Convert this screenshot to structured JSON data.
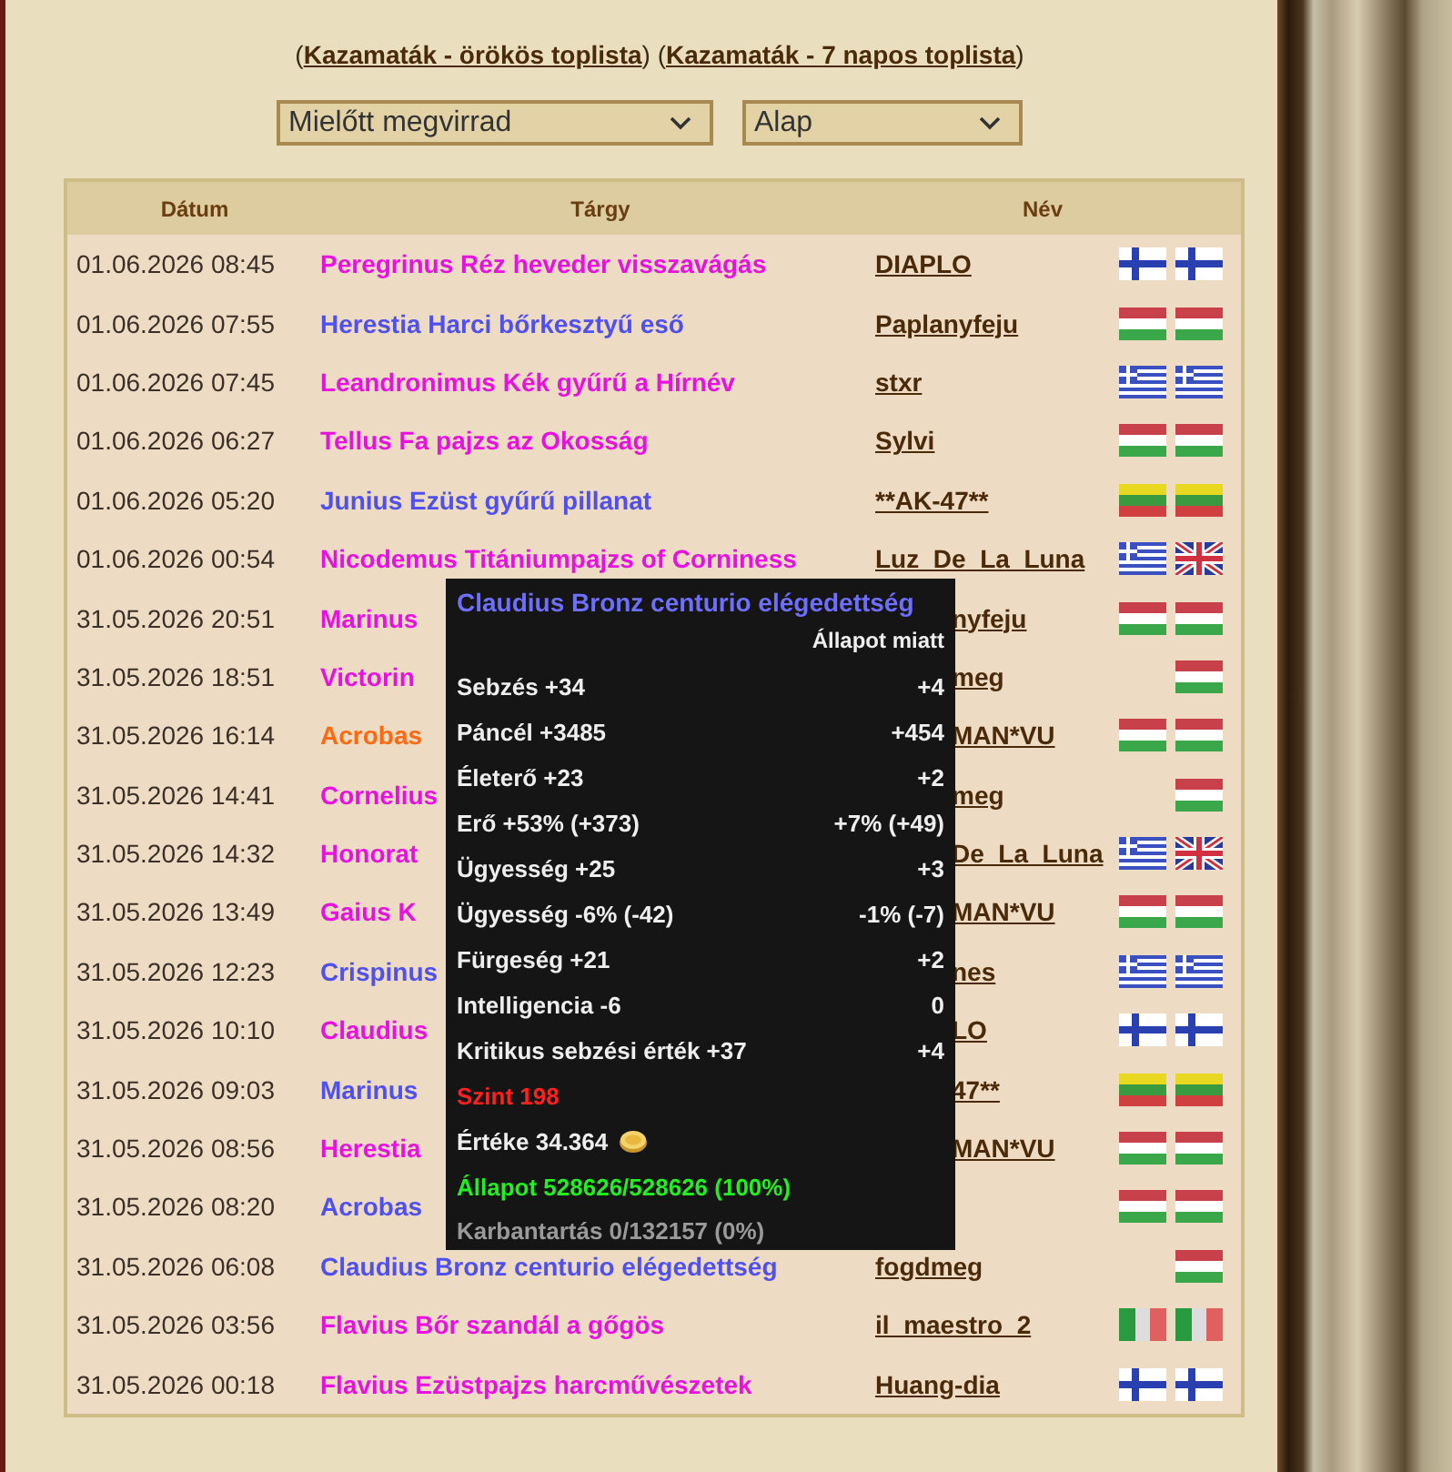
{
  "links": [
    {
      "kind": "text",
      "text": "("
    },
    {
      "kind": "link",
      "text": "Kazamaták - örökös toplista"
    },
    {
      "kind": "text",
      "text": ") ("
    },
    {
      "kind": "link",
      "text": "Kazamaták - 7 napos toplista"
    },
    {
      "kind": "text",
      "text": ")"
    }
  ],
  "selects": [
    {
      "value": "Mielőtt megvirrad"
    },
    {
      "value": "Alap"
    }
  ],
  "table": {
    "columns": [
      "Dátum",
      "Tárgy",
      "Név"
    ],
    "rows": [
      {
        "date": "01.06.2026 08:45",
        "item": "Peregrinus Réz heveder visszavágás",
        "color": "#e812e0",
        "name": "DIAPLO",
        "flags": [
          {
            "kind": "fi"
          },
          {
            "kind": "fi"
          }
        ]
      },
      {
        "date": "01.06.2026 07:55",
        "item": "Herestia Harci bőrkesztyű eső",
        "color": "#5050f0",
        "name": "Paplanyfeju",
        "flags": [
          {
            "kind": "hu"
          },
          {
            "kind": "hu"
          }
        ]
      },
      {
        "date": "01.06.2026 07:45",
        "item": "Leandronimus Kék gyűrű a Hírnév",
        "color": "#e812e0",
        "name": "stxr",
        "flags": [
          {
            "kind": "gr"
          },
          {
            "kind": "gr"
          }
        ]
      },
      {
        "date": "01.06.2026 06:27",
        "item": "Tellus Fa pajzs az Okosság",
        "color": "#e812e0",
        "name": "Sylvi",
        "flags": [
          {
            "kind": "hu"
          },
          {
            "kind": "hu"
          }
        ]
      },
      {
        "date": "01.06.2026 05:20",
        "item": "Junius Ezüst gyűrű pillanat",
        "color": "#5050f0",
        "name": "**AK-47**",
        "flags": [
          {
            "kind": "lt"
          },
          {
            "kind": "lt"
          }
        ]
      },
      {
        "date": "01.06.2026 00:54",
        "item": "Nicodemus Titániumpajzs of Corniness",
        "color": "#e812e0",
        "name": "Luz_De_La_Luna",
        "flags": [
          {
            "kind": "gr"
          },
          {
            "kind": "gb"
          }
        ]
      },
      {
        "date": "31.05.2026 20:51",
        "item": "Marinus",
        "color": "#e812e0",
        "name": "nyfeju",
        "name_hidden_start": true,
        "flags": [
          {
            "kind": "hu"
          },
          {
            "kind": "hu"
          }
        ]
      },
      {
        "date": "31.05.2026 18:51",
        "item": "Victorin",
        "color": "#e812e0",
        "name": "meg",
        "name_hidden_start": true,
        "flags": [
          {
            "kind": "hu"
          }
        ]
      },
      {
        "date": "31.05.2026 16:14",
        "item": "Acrobas",
        "color": "#ff6a10",
        "name": "MAN*VU",
        "name_hidden_start": true,
        "flags": [
          {
            "kind": "hu"
          },
          {
            "kind": "hu"
          }
        ]
      },
      {
        "date": "31.05.2026 14:41",
        "item": "Cornelius",
        "color": "#e812e0",
        "name": "meg",
        "name_hidden_start": true,
        "flags": [
          {
            "kind": "hu"
          }
        ]
      },
      {
        "date": "31.05.2026 14:32",
        "item": "Honorat",
        "color": "#e812e0",
        "name": "De_La_Luna",
        "name_hidden_start": true,
        "flags": [
          {
            "kind": "gr"
          },
          {
            "kind": "gb"
          }
        ]
      },
      {
        "date": "31.05.2026 13:49",
        "item": "Gaius K",
        "color": "#e812e0",
        "name": "MAN*VU",
        "name_hidden_start": true,
        "flags": [
          {
            "kind": "hu"
          },
          {
            "kind": "hu"
          }
        ]
      },
      {
        "date": "31.05.2026 12:23",
        "item": "Crispinus",
        "color": "#5050f0",
        "name": "nes",
        "name_hidden_start": true,
        "flags": [
          {
            "kind": "gr"
          },
          {
            "kind": "gr"
          }
        ]
      },
      {
        "date": "31.05.2026 10:10",
        "item": "Claudius",
        "color": "#e812e0",
        "name": "LO",
        "name_hidden_start": true,
        "flags": [
          {
            "kind": "fi"
          },
          {
            "kind": "fi"
          }
        ]
      },
      {
        "date": "31.05.2026 09:03",
        "item": "Marinus",
        "color": "#5050f0",
        "name": "47**",
        "name_hidden_start": true,
        "flags": [
          {
            "kind": "lt"
          },
          {
            "kind": "lt"
          }
        ]
      },
      {
        "date": "31.05.2026 08:56",
        "item": "Herestia",
        "color": "#e812e0",
        "name": "MAN*VU",
        "name_hidden_start": true,
        "flags": [
          {
            "kind": "hu"
          },
          {
            "kind": "hu"
          }
        ]
      },
      {
        "date": "31.05.2026 08:20",
        "item": "Acrobas",
        "color": "#5050f0",
        "flags": [
          {
            "kind": "hu"
          },
          {
            "kind": "hu"
          }
        ]
      },
      {
        "date": "31.05.2026 06:08",
        "item": "Claudius Bronz centurio elégedettség",
        "color": "#5050f0",
        "name": "fogdmeg",
        "flags": [
          {
            "kind": "hu"
          }
        ]
      },
      {
        "date": "31.05.2026 03:56",
        "item": "Flavius Bőr szandál a gőgös",
        "color": "#e812e0",
        "name": "il_maestro_2",
        "flags": [
          {
            "kind": "it"
          },
          {
            "kind": "it"
          }
        ]
      },
      {
        "date": "31.05.2026 00:18",
        "item": "Flavius Ezüstpajzs harcművészetek",
        "color": "#e812e0",
        "name": "Huang-dia",
        "flags": [
          {
            "kind": "fi"
          },
          {
            "kind": "fi"
          }
        ]
      }
    ]
  },
  "tooltip": {
    "title": "Claudius Bronz centurio elégedettség",
    "subheader": "Állapot miatt",
    "lines": [
      {
        "kind": "stat",
        "label": "Sebzés +34",
        "bonus": "+4"
      },
      {
        "kind": "stat",
        "label": "Páncél +3485",
        "bonus": "+454"
      },
      {
        "kind": "stat",
        "label": "Életerő +23",
        "bonus": "+2"
      },
      {
        "kind": "stat",
        "label": "Erő +53% (+373)",
        "bonus": "+7% (+49)"
      },
      {
        "kind": "stat",
        "label": "Ügyesség +25",
        "bonus": "+3"
      },
      {
        "kind": "stat",
        "label": "Ügyesség -6% (-42)",
        "bonus": "-1% (-7)"
      },
      {
        "kind": "stat",
        "label": "Fürgeség +21",
        "bonus": "+2"
      },
      {
        "kind": "stat",
        "label": "Intelligencia -6",
        "bonus": "0"
      },
      {
        "kind": "stat",
        "label": "Kritikus sebzési érték +37",
        "bonus": "+4"
      },
      {
        "kind": "level",
        "label": "Szint 198"
      },
      {
        "kind": "value",
        "label": "Értéke 34.364"
      },
      {
        "kind": "condition",
        "label": "Állapot 528626/528626 (100%)"
      },
      {
        "kind": "upkeep",
        "label": "Karbantartás 0/132157 (0%)"
      }
    ]
  }
}
